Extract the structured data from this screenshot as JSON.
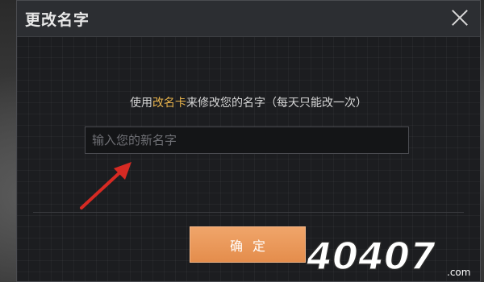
{
  "dialog": {
    "title": "更改名字",
    "close_icon": "close-icon",
    "instruction": {
      "prefix": "使用",
      "highlight": "改名卡",
      "suffix": "来修改您的名字（每天只能改一次）",
      "highlight_color": "#e9b44c"
    },
    "name_input": {
      "value": "",
      "placeholder": "输入您的新名字"
    },
    "confirm_label": "确定",
    "annotation": "red-arrow-icon"
  },
  "watermark": {
    "logo_text": "40407",
    "suffix": ".com"
  },
  "colors": {
    "dialog_bg": "#1c1d20",
    "titlebar_bg": "#2c2e32",
    "confirm_button": "#e48d4c",
    "arrow": "#d62a23"
  }
}
